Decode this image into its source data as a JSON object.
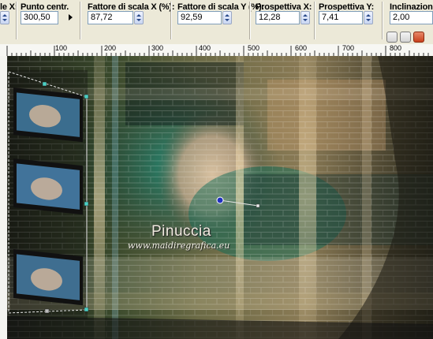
{
  "toolbar": {
    "fields": [
      {
        "id": "pos-x",
        "label": "le X:",
        "value": ""
      },
      {
        "id": "center-point",
        "label": "Punto centr.",
        "value": "300,50"
      },
      {
        "id": "scale-x",
        "label": "Fattore di scala X (%):",
        "value": "87,72"
      },
      {
        "id": "scale-y",
        "label": "Fattore di scala Y (%):",
        "value": "92,59"
      },
      {
        "id": "perspective-x",
        "label": "Prospettiva X:",
        "value": "12,28"
      },
      {
        "id": "perspective-y",
        "label": "Prospettiva Y:",
        "value": "7,41"
      },
      {
        "id": "skew",
        "label": "Inclinazione:",
        "value": "2,00"
      }
    ]
  },
  "ruler": {
    "labels": [
      "100",
      "200",
      "300",
      "400",
      "500",
      "600",
      "700",
      "800"
    ]
  },
  "canvas": {
    "watermark_main": "Pinuccia",
    "watermark_sub": "www.maidiregrafica.eu"
  },
  "colors": {
    "accent": "#7f9db9",
    "handle": "#4bd0c4",
    "pivot": "#2030c0"
  }
}
